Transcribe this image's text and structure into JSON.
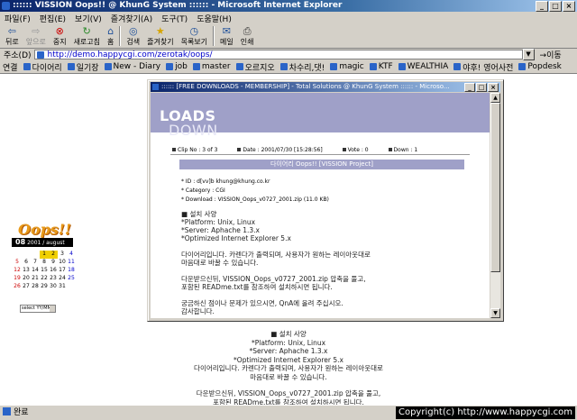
{
  "window": {
    "title": ":::::: VISSION Oops!! @ KhunG System :::::: - Microsoft Internet Explorer",
    "min": "_",
    "max": "□",
    "close": "×"
  },
  "menu": [
    "파일(F)",
    "편집(E)",
    "보기(V)",
    "즐겨찾기(A)",
    "도구(T)",
    "도움말(H)"
  ],
  "toolbar": {
    "back": "뒤로",
    "forward": "앞으로",
    "stop": "중지",
    "refresh": "새로고침",
    "home": "홈",
    "search": "검색",
    "favorites": "즐겨찾기",
    "history": "목록보기",
    "mail": "메일",
    "print": "인쇄"
  },
  "address": {
    "label": "주소(D)",
    "url": "http://demo.happycgi.com/zerotak/oops/",
    "go": "이동"
  },
  "links": {
    "label": "연결",
    "items": [
      "다이어리",
      "일기장",
      "New - Diary",
      "job",
      "master",
      "오르지오",
      "차수리,댓!",
      "magic",
      "KTF",
      "WEALTHIA",
      "야후! 영어사전",
      "Popdesk"
    ]
  },
  "calendar": {
    "logo": "Oops!!",
    "day": "08",
    "month_label": "2001 / august",
    "weeks": [
      [
        "",
        "",
        "",
        "1",
        "2",
        "3",
        "4"
      ],
      [
        "5",
        "6",
        "7",
        "8",
        "9",
        "10",
        "11"
      ],
      [
        "12",
        "13",
        "14",
        "15",
        "16",
        "17",
        "18"
      ],
      [
        "19",
        "20",
        "21",
        "22",
        "23",
        "24",
        "25"
      ],
      [
        "26",
        "27",
        "28",
        "29",
        "30",
        "31",
        ""
      ]
    ],
    "select_label": "select YY/MM"
  },
  "popup": {
    "title": ":::::: [FREE DOWNLOADS - MEMBERSHIP] - Total Solutions @ KhunG System :::::: - Microso...",
    "banner_light": "DOWN",
    "banner_bold": "LOADS",
    "clip": "Clip No : 3 of 3",
    "date": "Date : 2001/07/30 [15:28:56]",
    "vote": "Vote : 0",
    "down": "Down : 1",
    "subject": "다이어리 Oops!! [VISSION Project]",
    "id": "* ID : d[vv]b  khung@khung.co.kr",
    "category": "* Category : CGI",
    "download": "* Download : VISSION_Oops_v0727_2001.zip (11.0 KB)",
    "body": [
      "■ 설치 사양",
      "*Platform: Unix, Linux",
      "*Server: Aphache 1.3.x",
      "*Optimized Internet Explorer 5.x",
      "",
      "다이어리입니다. 카렌다가 출력되며, 사용자가 원하는 레이아웃대로",
      "마음대로 바꿀 수 있습니다.",
      "",
      "다운받으신뒤, VISSION_Oops_v0727_2001.zip 압축을 풀고,",
      "포함된 READme.txt를 참조하여 설치하시면 됩니다.",
      "",
      "궁금하신 점이나 문제가 있으시면, QnA에 올려 주십시오.",
      "감사합니다."
    ]
  },
  "main_text": [
    "■ 설치 사양",
    "*Platform: Unix, Linux",
    "*Server: Aphache 1.3.x",
    "*Optimized Internet Explorer 5.x",
    "다이어리입니다. 카렌다가 출력되며, 사용자가 원하는 레이아웃대로",
    "마음대로 바꿀 수 있습니다.",
    "다운받으신뒤, VISSION_Oops_v0727_2001.zip 압축을 풀고,",
    "포함된 READme.txt를 참조하여 설치하시면 됩니다."
  ],
  "status": {
    "text": "완료",
    "copyright": "Copyright(c) http://www.happycgi.com"
  }
}
